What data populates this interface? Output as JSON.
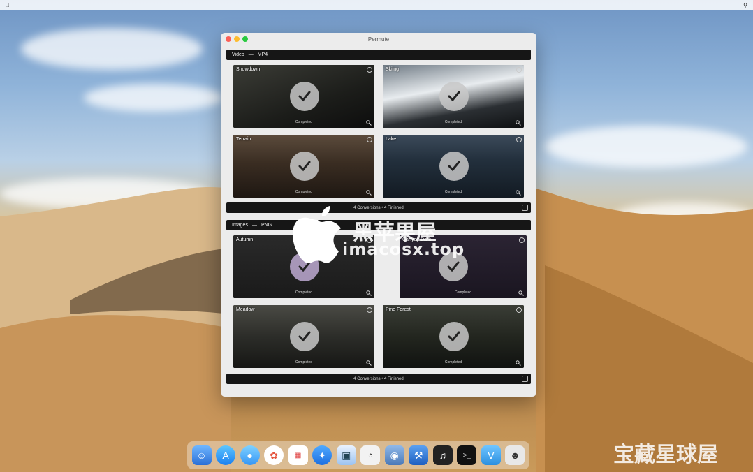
{
  "menubar": {
    "left_items": [
      "",
      "",
      "",
      "",
      "",
      ""
    ],
    "right_items": [
      "",
      "",
      "",
      ""
    ]
  },
  "window": {
    "title": "Permute",
    "video_section": {
      "label": "Video",
      "separator": "—",
      "format": "MP4",
      "footer": "4 Conversions • 4 Finished",
      "tiles": [
        {
          "name": "Showdown",
          "status": "Completed"
        },
        {
          "name": "Skiing",
          "status": "Completed"
        },
        {
          "name": "Terrain",
          "status": "Completed"
        },
        {
          "name": "Lake",
          "status": "Completed"
        }
      ]
    },
    "images_section": {
      "label": "Images",
      "separator": "—",
      "format": "PNG",
      "footer": "4 Conversions • 4 Finished",
      "tiles": [
        {
          "name": "Autumn",
          "status": "Completed"
        },
        {
          "name": "Canyon Dark",
          "status": "Completed"
        },
        {
          "name": "Meadow",
          "status": "Completed"
        },
        {
          "name": "Pine Forest",
          "status": "Completed"
        }
      ]
    }
  },
  "watermark": {
    "line1": "黑苹果屋",
    "line2": "imacosx.top",
    "corner": "宝藏星球屋"
  },
  "dock": {
    "icons": [
      "finder-icon",
      "app-store-icon",
      "messages-icon",
      "photos-icon",
      "calendar-icon",
      "safari-icon",
      "preview-icon",
      "activity-monitor-icon",
      "disk-utility-icon",
      "xcode-icon",
      "audio-icon",
      "terminal-icon",
      "vectorize-icon",
      "robot-icon"
    ]
  }
}
